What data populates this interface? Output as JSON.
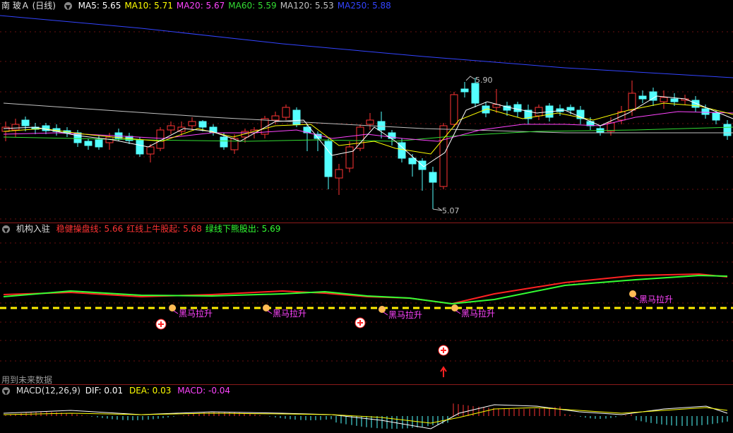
{
  "stock_title": "南 玻Ａ (日线)",
  "ma_legend": [
    {
      "label": "MA5: 5.65",
      "color": "#ffffff"
    },
    {
      "label": "MA10: 5.71",
      "color": "#ffff00"
    },
    {
      "label": "MA20: 5.67",
      "color": "#ff44ff"
    },
    {
      "label": "MA60: 5.59",
      "color": "#33dd33"
    },
    {
      "label": "MA120: 5.53",
      "color": "#c0c0c0"
    },
    {
      "label": "MA250: 5.88",
      "color": "#3344ff"
    }
  ],
  "price_high_label": "5.90",
  "price_low_label": "5.07",
  "indicator": {
    "name": "机构入驻",
    "legend": [
      {
        "label": "稳健操盘线: 5.66",
        "color": "#ff3333"
      },
      {
        "label": "红线上牛股起: 5.68",
        "color": "#ff3333"
      },
      {
        "label": "绿线下熊股出: 5.69",
        "color": "#33ff33"
      }
    ],
    "signal_label": "黑马拉升",
    "future_data_note": "用到未来数据"
  },
  "macd": {
    "title": "MACD(12,26,9)",
    "dif": "DIF: 0.01",
    "dea": "DEA: 0.03",
    "macd": "MACD: -0.04"
  },
  "colors": {
    "up": "#ff3333",
    "down": "#54ffff",
    "background": "#000000",
    "separator": "#8b1a1a"
  }
}
